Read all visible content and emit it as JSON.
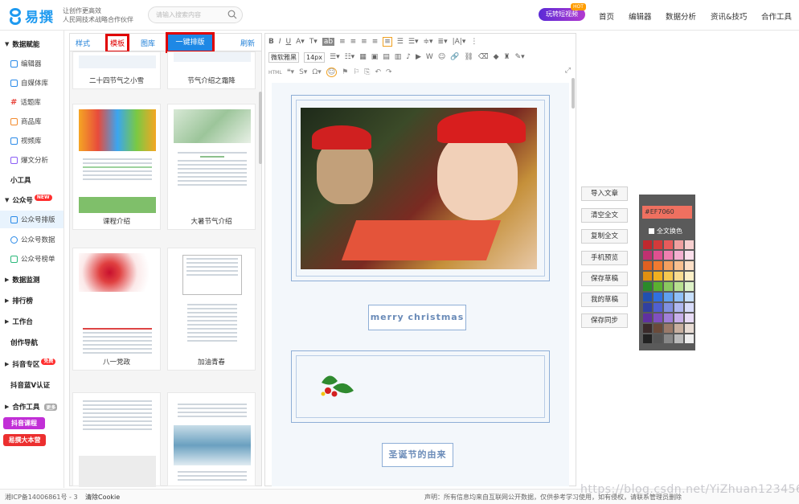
{
  "header": {
    "logo": "易撰",
    "slogan_line1": "让创作更高效",
    "slogan_line2": "人民网技术战略合作伙伴",
    "search_placeholder": "请输入搜索内容",
    "video_button": "玩转短视频",
    "hot_badge": "HOT",
    "nav": [
      "首页",
      "编辑器",
      "数据分析",
      "资讯&技巧",
      "合作工具"
    ]
  },
  "sidebar": {
    "data_section": "数据赋能",
    "items": [
      "编辑器",
      "自媒体库",
      "话题库",
      "商品库",
      "视频库",
      "爆文分析"
    ],
    "tools": "小工具",
    "gzh": "公众号",
    "new_badge": "NEW",
    "gzh_items": [
      "公众号排版",
      "公众号数据",
      "公众号榜单"
    ],
    "monitor": "数据监测",
    "rank": "排行榜",
    "workbench": "工作台",
    "creation_nav": "创作导航",
    "douyin": "抖音专区",
    "free_badge": "免费",
    "douyin_v": "抖音蓝V认证",
    "cooperation": "合作工具",
    "more_badge": "更多",
    "course_btn": "抖音课程",
    "book_btn": "易撰大本营"
  },
  "panel": {
    "tabs": [
      "样式",
      "模板",
      "图库"
    ],
    "active_tab": "一键排版",
    "refresh": "刷新",
    "cards": [
      "二十四节气之小雪",
      "节气介绍之霜降",
      "课程介绍",
      "大暑节气介绍",
      "八一党政",
      "加油青春",
      "",
      ""
    ]
  },
  "editor": {
    "font_family": "微软雅黑",
    "font_size": "14px",
    "html_label": "HTML",
    "christmas_title": "merry christmas",
    "origin_title": "圣诞节的由来"
  },
  "actions": [
    "导入文章",
    "清空全文",
    "复制全文",
    "手机预览",
    "保存草稿",
    "我的草稿",
    "保存同步"
  ],
  "palette": {
    "hex": "#EF7060",
    "all_color": "全文换色",
    "colors": [
      "#c0282e",
      "#d43a3a",
      "#e85b5b",
      "#f0a0a0",
      "#f7d0d0",
      "#c03070",
      "#e05090",
      "#f080b0",
      "#f4b0d0",
      "#fbe0ec",
      "#e06020",
      "#f07a30",
      "#f4a060",
      "#f8c090",
      "#fce0c8",
      "#e09010",
      "#f0b020",
      "#f4c850",
      "#f8dc90",
      "#fcf0c8",
      "#2a8a2a",
      "#5ab030",
      "#8ac860",
      "#b8e090",
      "#def2c8",
      "#2050b0",
      "#3070e0",
      "#60a0f0",
      "#90c0f8",
      "#c8e0fc",
      "#3040a0",
      "#5060d0",
      "#8090e0",
      "#b0b8f0",
      "#d8dcfa",
      "#6030a0",
      "#8050c0",
      "#a080d8",
      "#c8b0ea",
      "#e8dcf6",
      "#3a2a2a",
      "#6a4a3a",
      "#9a7a6a",
      "#c8b0a0",
      "#e8dcd4",
      "#222222",
      "#555555",
      "#888888",
      "#bbbbbb",
      "#eeeeee"
    ]
  },
  "footer": {
    "icp": "湘ICP备14006861号 - 3",
    "cookie": "清除Cookie",
    "statement": "声明：所有信息均来自互联网公开数据，仅供参考学习使用，如有侵权，请联系管理员删除",
    "watermark": "https://blog.csdn.net/YiZhuan123456"
  }
}
